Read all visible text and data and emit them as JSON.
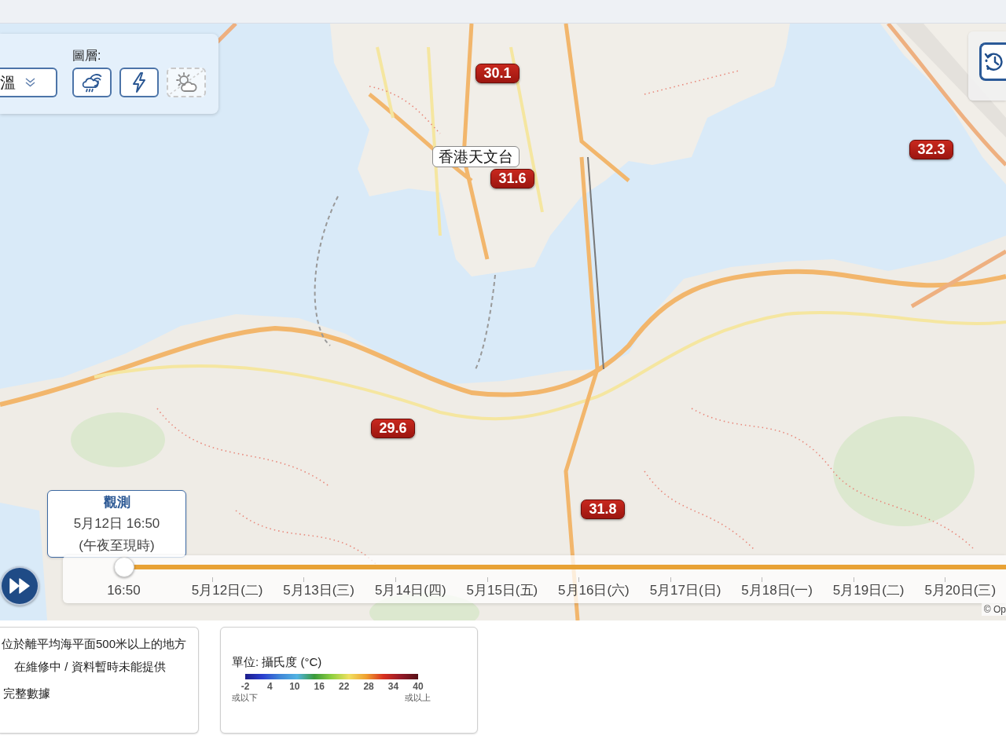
{
  "layer_panel": {
    "variable_select": {
      "value": "溫"
    },
    "layers_label": "圖層:",
    "layers": [
      {
        "kind": "storm",
        "on": true
      },
      {
        "kind": "lightning",
        "on": true
      },
      {
        "kind": "weather",
        "on": false
      }
    ]
  },
  "map": {
    "station_label": "香港天文台",
    "temperature_markers": [
      "30.1",
      "31.6",
      "32.3",
      "29.6",
      "31.8"
    ],
    "attribution": "© Op"
  },
  "observation_tooltip": {
    "title": "觀測",
    "time": "5月12日 16:50",
    "note": "(午夜至現時)"
  },
  "timeline": {
    "level": 0,
    "current_label": "16:50",
    "dates": [
      "5月12日(二)",
      "5月13日(三)",
      "5月14日(四)",
      "5月15日(五)",
      "5月16日(六)",
      "5月17日(日)",
      "5月18日(一)",
      "5月19日(二)",
      "5月20日(三)"
    ]
  },
  "legend_notes": [
    "位於離平均海平面500米以上的地方",
    "在維修中 / 資料暫時未能提供",
    "完整數據"
  ],
  "color_scale": {
    "unit": "單位: 攝氏度 (°C)",
    "ticks": [
      "-2",
      "4",
      "10",
      "16",
      "22",
      "28",
      "34",
      "40"
    ],
    "low_note": "或以下",
    "high_note": "或以上"
  }
}
